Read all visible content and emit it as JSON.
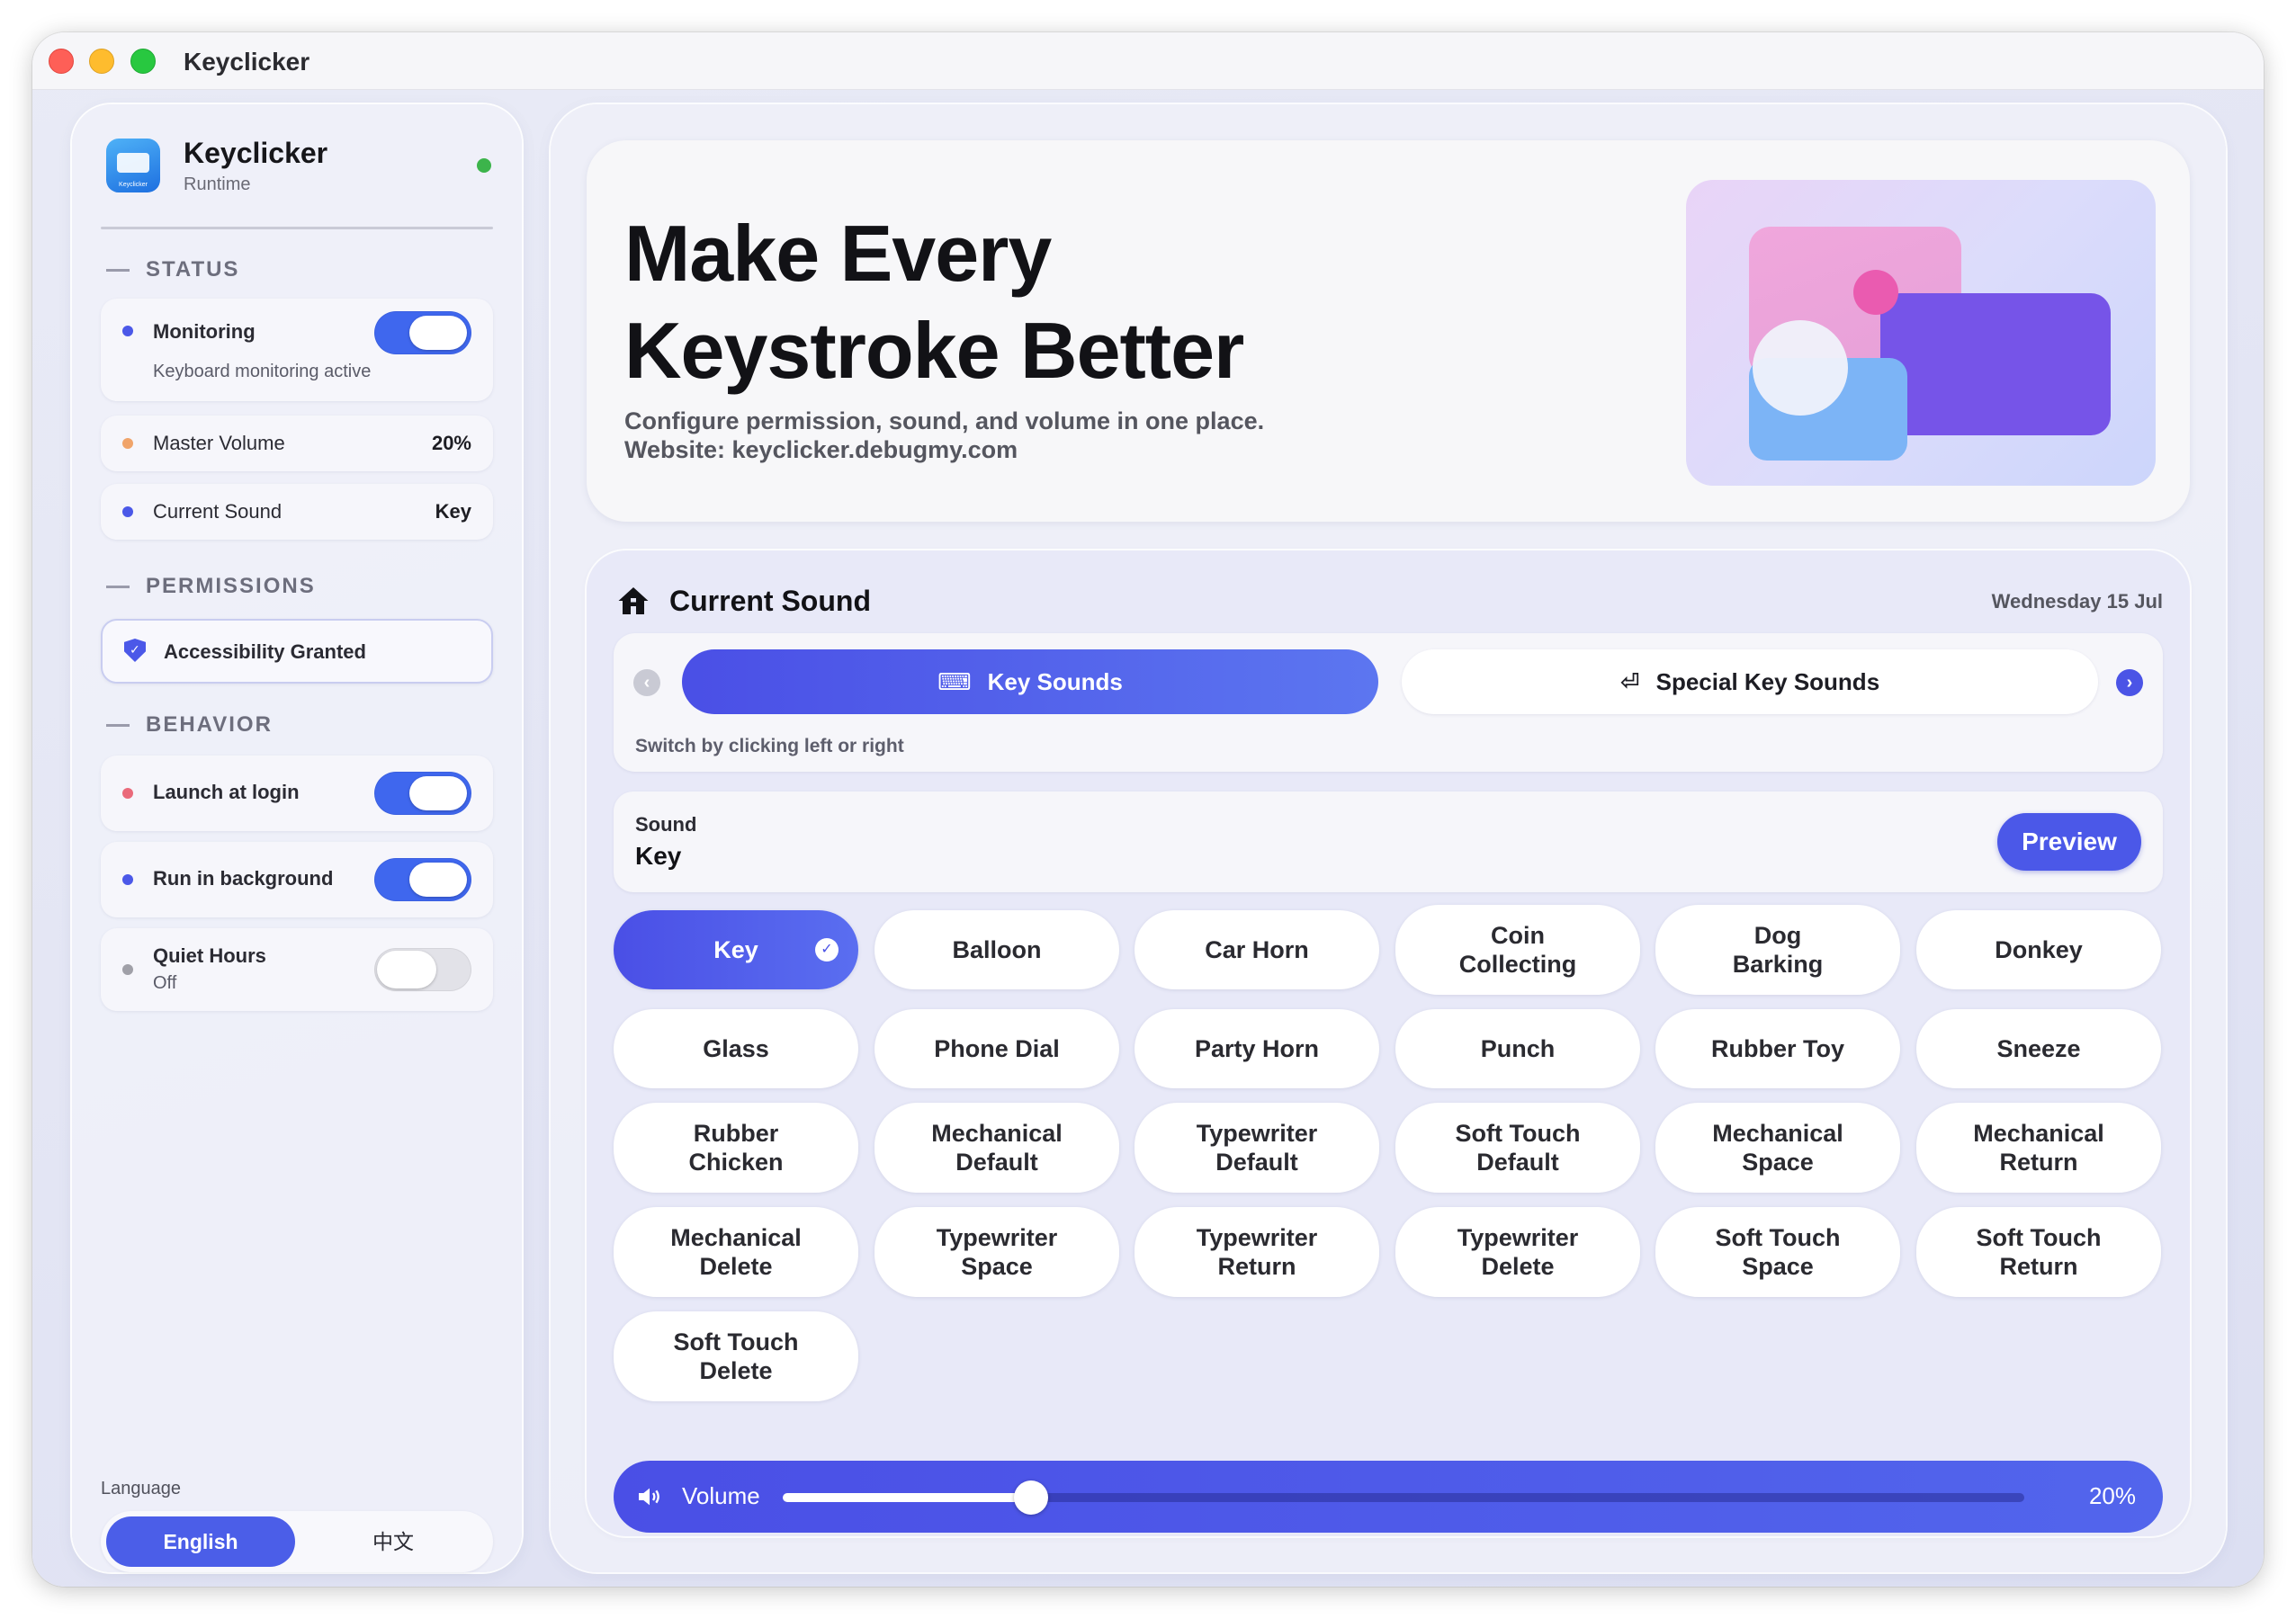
{
  "window": {
    "title": "Keyclicker"
  },
  "sidebar": {
    "app_name": "Keyclicker",
    "app_sub": "Runtime",
    "app_icon_label": "Keyclicker",
    "status_head": "STATUS",
    "monitoring": {
      "label": "Monitoring",
      "sub": "Keyboard monitoring active",
      "on": true
    },
    "master_volume": {
      "label": "Master Volume",
      "value": "20%"
    },
    "current_sound": {
      "label": "Current Sound",
      "value": "Key"
    },
    "permissions_head": "PERMISSIONS",
    "accessibility": {
      "label": "Accessibility Granted"
    },
    "behavior_head": "BEHAVIOR",
    "launch_login": {
      "label": "Launch at login",
      "on": true
    },
    "run_background": {
      "label": "Run in background",
      "on": true
    },
    "quiet_hours": {
      "label": "Quiet Hours",
      "sub": "Off",
      "on": false
    },
    "language_label": "Language",
    "languages": [
      "English",
      "中文"
    ],
    "colors": {
      "accent": "#4b58e8",
      "green": "#3cb44b",
      "orange": "#f0a46a",
      "red": "#ea6a7a",
      "gray": "#a0a0a8"
    }
  },
  "hero": {
    "title_line1": "Make Every",
    "title_line2": "Keystroke Better",
    "sub_line1": "Configure permission, sound, and volume in one place.",
    "sub_line2": "Website: keyclicker.debugmy.com"
  },
  "sound_panel": {
    "title": "Current Sound",
    "date": "Wednesday 15 Jul",
    "tabs": [
      {
        "label": "Key Sounds",
        "icon": "keyboard-icon",
        "active": true
      },
      {
        "label": "Special Key Sounds",
        "icon": "return-icon",
        "active": false
      }
    ],
    "tabs_hint": "Switch by clicking left or right",
    "sound_label": "Sound",
    "sound_value": "Key",
    "preview_label": "Preview",
    "sounds": [
      "Key",
      "Balloon",
      "Car Horn",
      "Coin\nCollecting",
      "Dog\nBarking",
      "Donkey",
      "Glass",
      "Phone Dial",
      "Party Horn",
      "Punch",
      "Rubber Toy",
      "Sneeze",
      "Rubber\nChicken",
      "Mechanical\nDefault",
      "Typewriter\nDefault",
      "Soft Touch\nDefault",
      "Mechanical\nSpace",
      "Mechanical\nReturn",
      "Mechanical\nDelete",
      "Typewriter\nSpace",
      "Typewriter\nReturn",
      "Typewriter\nDelete",
      "Soft Touch\nSpace",
      "Soft Touch\nReturn",
      "Soft Touch\nDelete"
    ],
    "selected_sound": "Key",
    "volume": {
      "label": "Volume",
      "value_text": "20%",
      "fraction": 0.2
    }
  }
}
